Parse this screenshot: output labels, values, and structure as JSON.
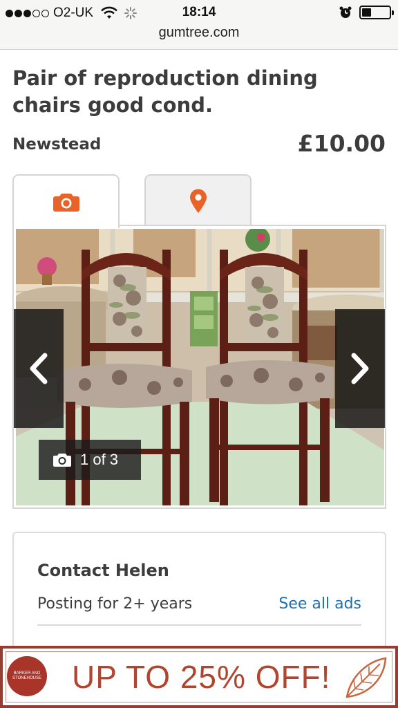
{
  "status_bar": {
    "carrier": "O2-UK",
    "time": "18:14",
    "url": "gumtree.com",
    "signal_bars_filled": 3,
    "signal_bars_total": 5,
    "battery_level": 0.35
  },
  "listing": {
    "title": "Pair of reproduction dining chairs good cond.",
    "location": "Newstead",
    "price": "£10.00"
  },
  "tabs": [
    {
      "icon": "camera-icon",
      "active": true
    },
    {
      "icon": "map-pin-icon",
      "active": false
    }
  ],
  "gallery": {
    "counter": "1 of 3",
    "current_image": 1,
    "total_images": 3
  },
  "contact": {
    "title": "Contact Helen",
    "posting_for": "Posting for 2+ years",
    "see_all_ads": "See all ads"
  },
  "ad": {
    "brand": "BARKER AND STONEHOUSE",
    "text": "UP TO 25% OFF!"
  },
  "colors": {
    "accent_orange": "#e8632a",
    "link_blue": "#1f6fb3",
    "ad_red": "#b2452f"
  }
}
